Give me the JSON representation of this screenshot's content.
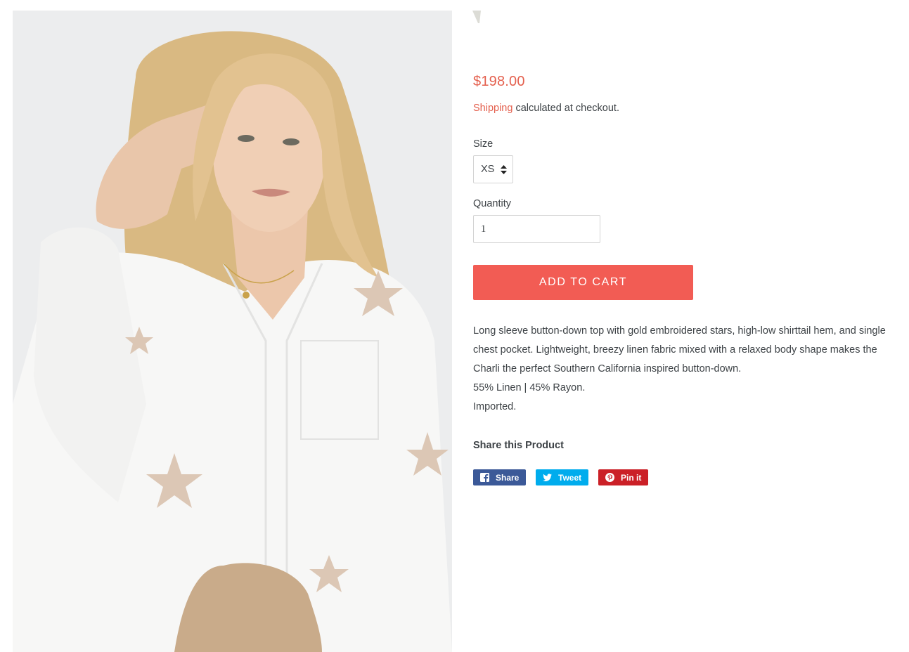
{
  "product": {
    "price": "$198.00",
    "shipping_link": "Shipping",
    "shipping_text": " calculated at checkout.",
    "size_label": "Size",
    "size_value": "XS",
    "quantity_label": "Quantity",
    "quantity_value": "1",
    "add_to_cart_label": "Add to cart",
    "description": [
      "Long sleeve button-down top with gold embroidered stars, high-low shirttail hem, and single chest pocket. Lightweight, breezy linen fabric mixed with a relaxed body shape makes the Charli the perfect Southern California inspired button-down.",
      "55% Linen | 45% Rayon.",
      "Imported."
    ]
  },
  "share": {
    "title": "Share this Product",
    "facebook_label": "Share",
    "twitter_label": "Tweet",
    "pinterest_label": "Pin it"
  },
  "icons": {
    "facebook": "facebook-icon",
    "twitter": "twitter-icon",
    "pinterest": "pinterest-icon",
    "select_arrows": "select-arrows-icon"
  },
  "colors": {
    "accent": "#e4604e",
    "button": "#f25c54",
    "text": "#3d4246",
    "facebook": "#3b5998",
    "twitter": "#00aced",
    "pinterest": "#cb2027"
  }
}
